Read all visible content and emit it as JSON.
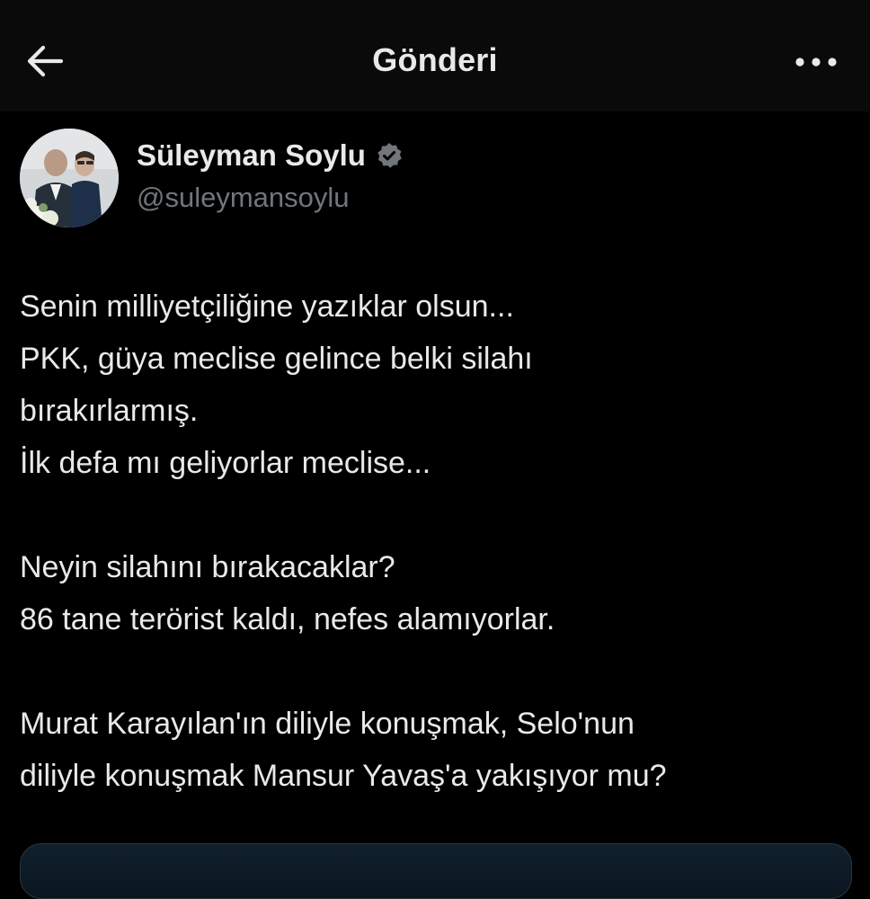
{
  "header": {
    "title": "Gönderi",
    "back_icon": "arrow-left-icon",
    "more_icon": "more-horizontal-icon"
  },
  "author": {
    "name": "Süleyman Soylu",
    "handle": "@suleymansoylu",
    "verified_icon": "verified-badge-icon",
    "verified_color": "#71767b"
  },
  "tweet": {
    "lines": [
      "Senin milliyetçiliğine yazıklar olsun...",
      "PKK, güya meclise gelince belki silahı",
      "bırakırlarmış.",
      "İlk defa mı geliyorlar meclise...",
      "",
      "Neyin silahını bırakacaklar?",
      "86 tane terörist kaldı, nefes alamıyorlar.",
      "",
      "Murat Karayılan'ın diliyle konuşmak, Selo'nun",
      "diliyle konuşmak Mansur Yavaş'a yakışıyor mu?"
    ]
  },
  "colors": {
    "background": "#000000",
    "header_bg": "#0a0a0a",
    "text_primary": "#e7e9ea",
    "text_secondary": "#71767b"
  }
}
